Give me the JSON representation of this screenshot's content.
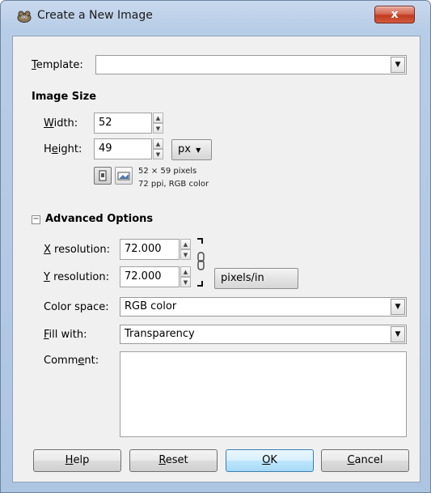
{
  "window": {
    "title": "Create a New Image",
    "close_glyph": "x",
    "icon": "gimp-icon"
  },
  "template": {
    "label_ul": "T",
    "label_rest": "emplate:",
    "value": ""
  },
  "image_size": {
    "title": "Image Size",
    "width_label_ul": "W",
    "width_label_rest": "idth:",
    "width_value": "52",
    "height_label_pre": "H",
    "height_label_ul": "e",
    "height_label_rest": "ight:",
    "height_value": "49",
    "unit": "px",
    "info_line1": "52 × 59 pixels",
    "info_line2": "72 ppi, RGB color"
  },
  "advanced": {
    "title": "Advanced Options",
    "expander_glyph": "−",
    "x_res_label_ul": "X",
    "x_res_label_rest": " resolution:",
    "x_res_value": "72.000",
    "y_res_label_ul": "Y",
    "y_res_label_rest": " resolution:",
    "y_res_value": "72.000",
    "res_unit": "pixels/in",
    "color_space_label": "Color space:",
    "color_space_value": "RGB color",
    "fill_label_ul": "F",
    "fill_label_rest": "ill with:",
    "fill_value": "Transparency",
    "comment_label_pre": "Comm",
    "comment_label_ul": "e",
    "comment_label_rest": "nt:",
    "comment_value": ""
  },
  "buttons": {
    "help_ul": "H",
    "help_rest": "elp",
    "reset_ul": "R",
    "reset_rest": "eset",
    "ok_ul": "O",
    "ok_rest": "K",
    "cancel_ul": "C",
    "cancel_rest": "ancel"
  },
  "colors": {
    "title_bar": "#b7cce6",
    "dialog_bg": "#f0f0f0",
    "close_button": "#c2391f",
    "default_button": "#bee6fd"
  }
}
